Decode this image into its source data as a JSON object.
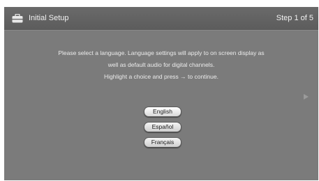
{
  "header": {
    "title": "Initial Setup",
    "step": "Step 1 of 5",
    "icon": "toolbox-icon"
  },
  "instructions": {
    "line1": "Please select a language. Language settings will apply to on screen display as",
    "line2": "well as default audio for digital channels.",
    "line3": "Highlight a choice and press → to continue."
  },
  "languages": {
    "items": [
      {
        "label": "English"
      },
      {
        "label": "Español"
      },
      {
        "label": "Français"
      }
    ],
    "selected": "English"
  },
  "navigation": {
    "next_icon": "play-arrow-icon"
  },
  "colors": {
    "background": "#7b7b7b",
    "header": "#5f5f5f",
    "text": "#f2f2f2",
    "button": "#e6e6e6"
  }
}
